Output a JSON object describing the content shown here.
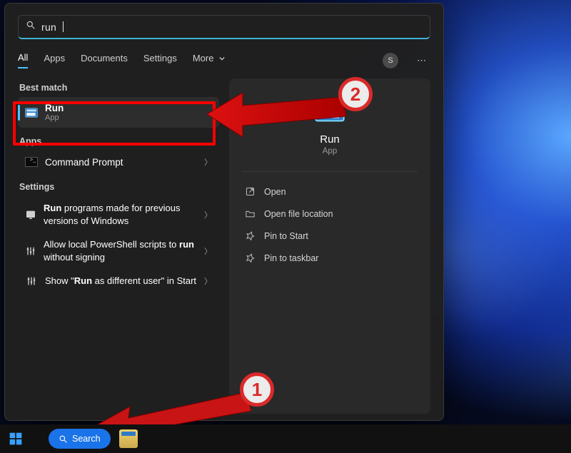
{
  "search": {
    "query": "run"
  },
  "tabs": {
    "all": "All",
    "apps": "Apps",
    "documents": "Documents",
    "settings": "Settings",
    "more": "More"
  },
  "avatar_initial": "S",
  "left": {
    "best_match": "Best match",
    "top": {
      "title_bold": "Run",
      "sub": "App"
    },
    "apps_label": "Apps",
    "apps": [
      {
        "title": "Command Prompt"
      }
    ],
    "settings_label": "Settings",
    "settings": [
      {
        "pre": "",
        "bold": "Run",
        "post": " programs made for previous versions of Windows"
      },
      {
        "pre": "Allow local PowerShell scripts to ",
        "bold": "run",
        "post": " without signing"
      },
      {
        "pre": "Show \"",
        "bold": "Run",
        "post": " as different user\" in Start"
      }
    ]
  },
  "right": {
    "title": "Run",
    "sub": "App",
    "actions": {
      "open": "Open",
      "loc": "Open file location",
      "pin_start": "Pin to Start",
      "pin_task": "Pin to taskbar"
    }
  },
  "taskbar": {
    "search": "Search"
  },
  "annotations": {
    "one": "1",
    "two": "2"
  }
}
